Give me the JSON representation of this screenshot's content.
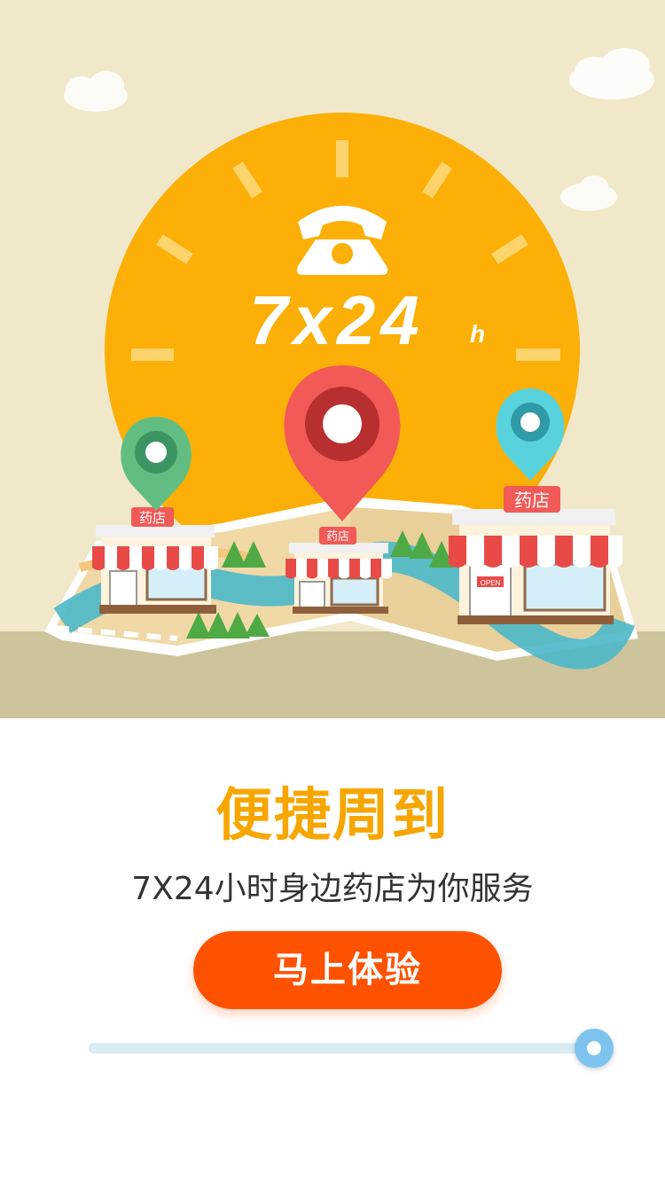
{
  "hero": {
    "big_text": "7x24",
    "big_text_suffix": "h",
    "store_sign": "药店",
    "open_sign": "OPEN",
    "colors": {
      "sky": "#f0e8c9",
      "ground": "#cdc49c",
      "sun": "#fcaf06",
      "pin_red": "#f25a57",
      "pin_green": "#62bd83",
      "pin_cyan": "#58d3de"
    }
  },
  "headline": "便捷周到",
  "subtitle": "7X24小时身边药店为你服务",
  "cta": {
    "label": "马上体验",
    "color": "#ff5200"
  },
  "pager": {
    "progress": 1.0
  }
}
